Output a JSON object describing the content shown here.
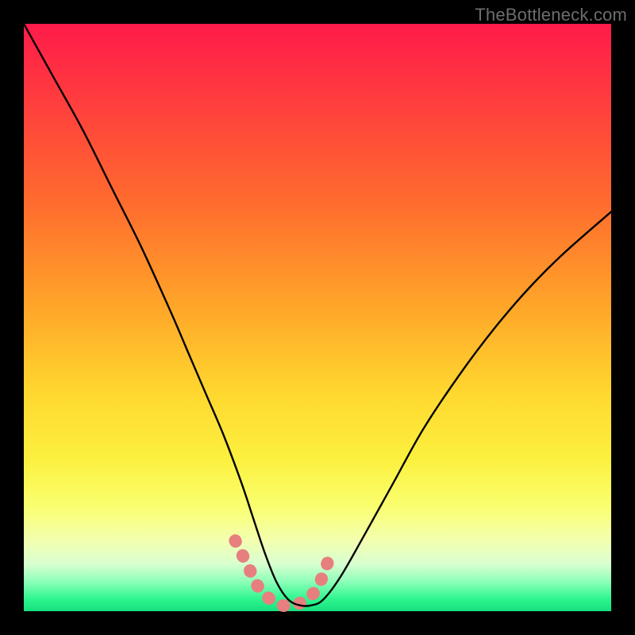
{
  "watermark": {
    "text": "TheBottleneck.com"
  },
  "chart_data": {
    "type": "line",
    "title": "",
    "xlabel": "",
    "ylabel": "",
    "xlim": [
      0,
      100
    ],
    "ylim": [
      0,
      100
    ],
    "grid": false,
    "legend": false,
    "background_gradient": {
      "direction": "vertical",
      "stops": [
        {
          "pos": 0.0,
          "color": "#ff1b4a"
        },
        {
          "pos": 0.3,
          "color": "#ff6a2e"
        },
        {
          "pos": 0.63,
          "color": "#ffd82f"
        },
        {
          "pos": 0.82,
          "color": "#faff6e"
        },
        {
          "pos": 0.95,
          "color": "#8cffb8"
        },
        {
          "pos": 1.0,
          "color": "#16e07f"
        }
      ]
    },
    "series": [
      {
        "name": "bottleneck-curve",
        "color": "#000000",
        "stroke_width": 2,
        "x": [
          0,
          5,
          10,
          15,
          20,
          25,
          28,
          31,
          34,
          37,
          39,
          41,
          43,
          45,
          47,
          49,
          51,
          54,
          58,
          63,
          68,
          74,
          80,
          86,
          92,
          100
        ],
        "y": [
          100,
          91,
          82,
          72,
          62,
          51,
          44,
          37,
          30,
          22,
          16,
          10,
          5,
          2,
          1,
          1,
          2,
          6,
          13,
          22,
          31,
          40,
          48,
          55,
          61,
          68
        ]
      },
      {
        "name": "bottleneck-highlight",
        "color": "#e77f7f",
        "stroke_width": 10,
        "linecap": "round",
        "x": [
          36,
          38,
          40,
          42,
          44,
          46,
          48,
          50,
          52
        ],
        "y": [
          12,
          8,
          4,
          2,
          1,
          1,
          2,
          4,
          9
        ]
      }
    ],
    "annotations": []
  }
}
